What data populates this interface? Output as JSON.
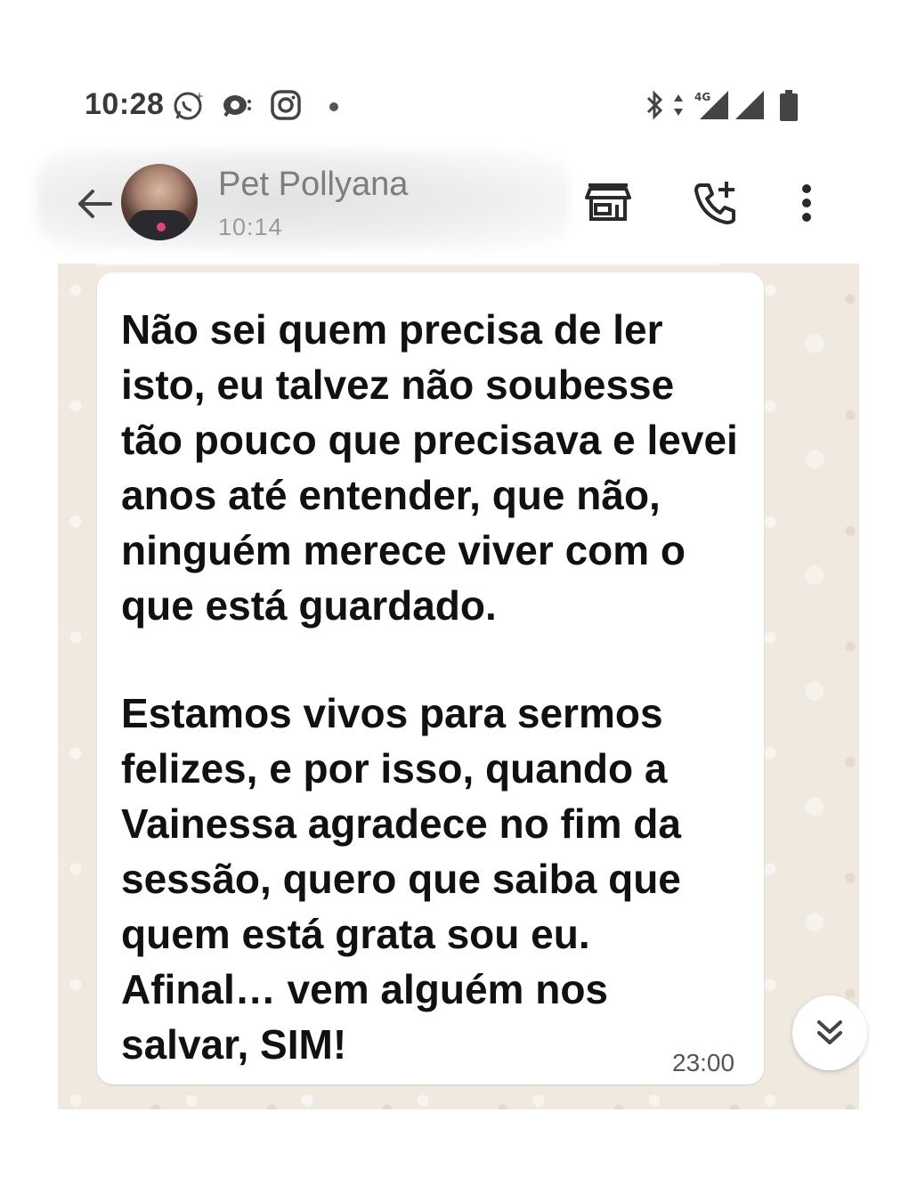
{
  "status_bar": {
    "time": "10:28",
    "icons": [
      "whatsapp-icon",
      "chat-bubble-icon",
      "instagram-icon",
      "notification-dot",
      "bluetooth-icon",
      "data-arrows-icon",
      "signal-4g-icon",
      "signal-icon",
      "battery-icon"
    ],
    "network_label": "4G"
  },
  "header": {
    "contact_name": "Pet Pollyana",
    "last_seen": "10:14",
    "icons": [
      "back-arrow-icon",
      "storefront-icon",
      "add-call-icon",
      "more-vert-icon"
    ]
  },
  "message": {
    "paragraph_1": "Não sei quem precisa de ler isto, eu talvez não soubesse tão pouco que precisava e levei anos até entender, que não, ninguém merece viver com o que está guardado.",
    "paragraph_2": "Estamos vivos para sermos felizes, e por isso, quando a Vainessa agradece no fim da sessão, quero que saiba que quem está grata sou eu. Afinal… vem alguém nos salvar, SIM!",
    "time": "23:00"
  },
  "colors": {
    "chat_background": "#efe9df",
    "bubble": "#ffffff",
    "text": "#111111"
  }
}
